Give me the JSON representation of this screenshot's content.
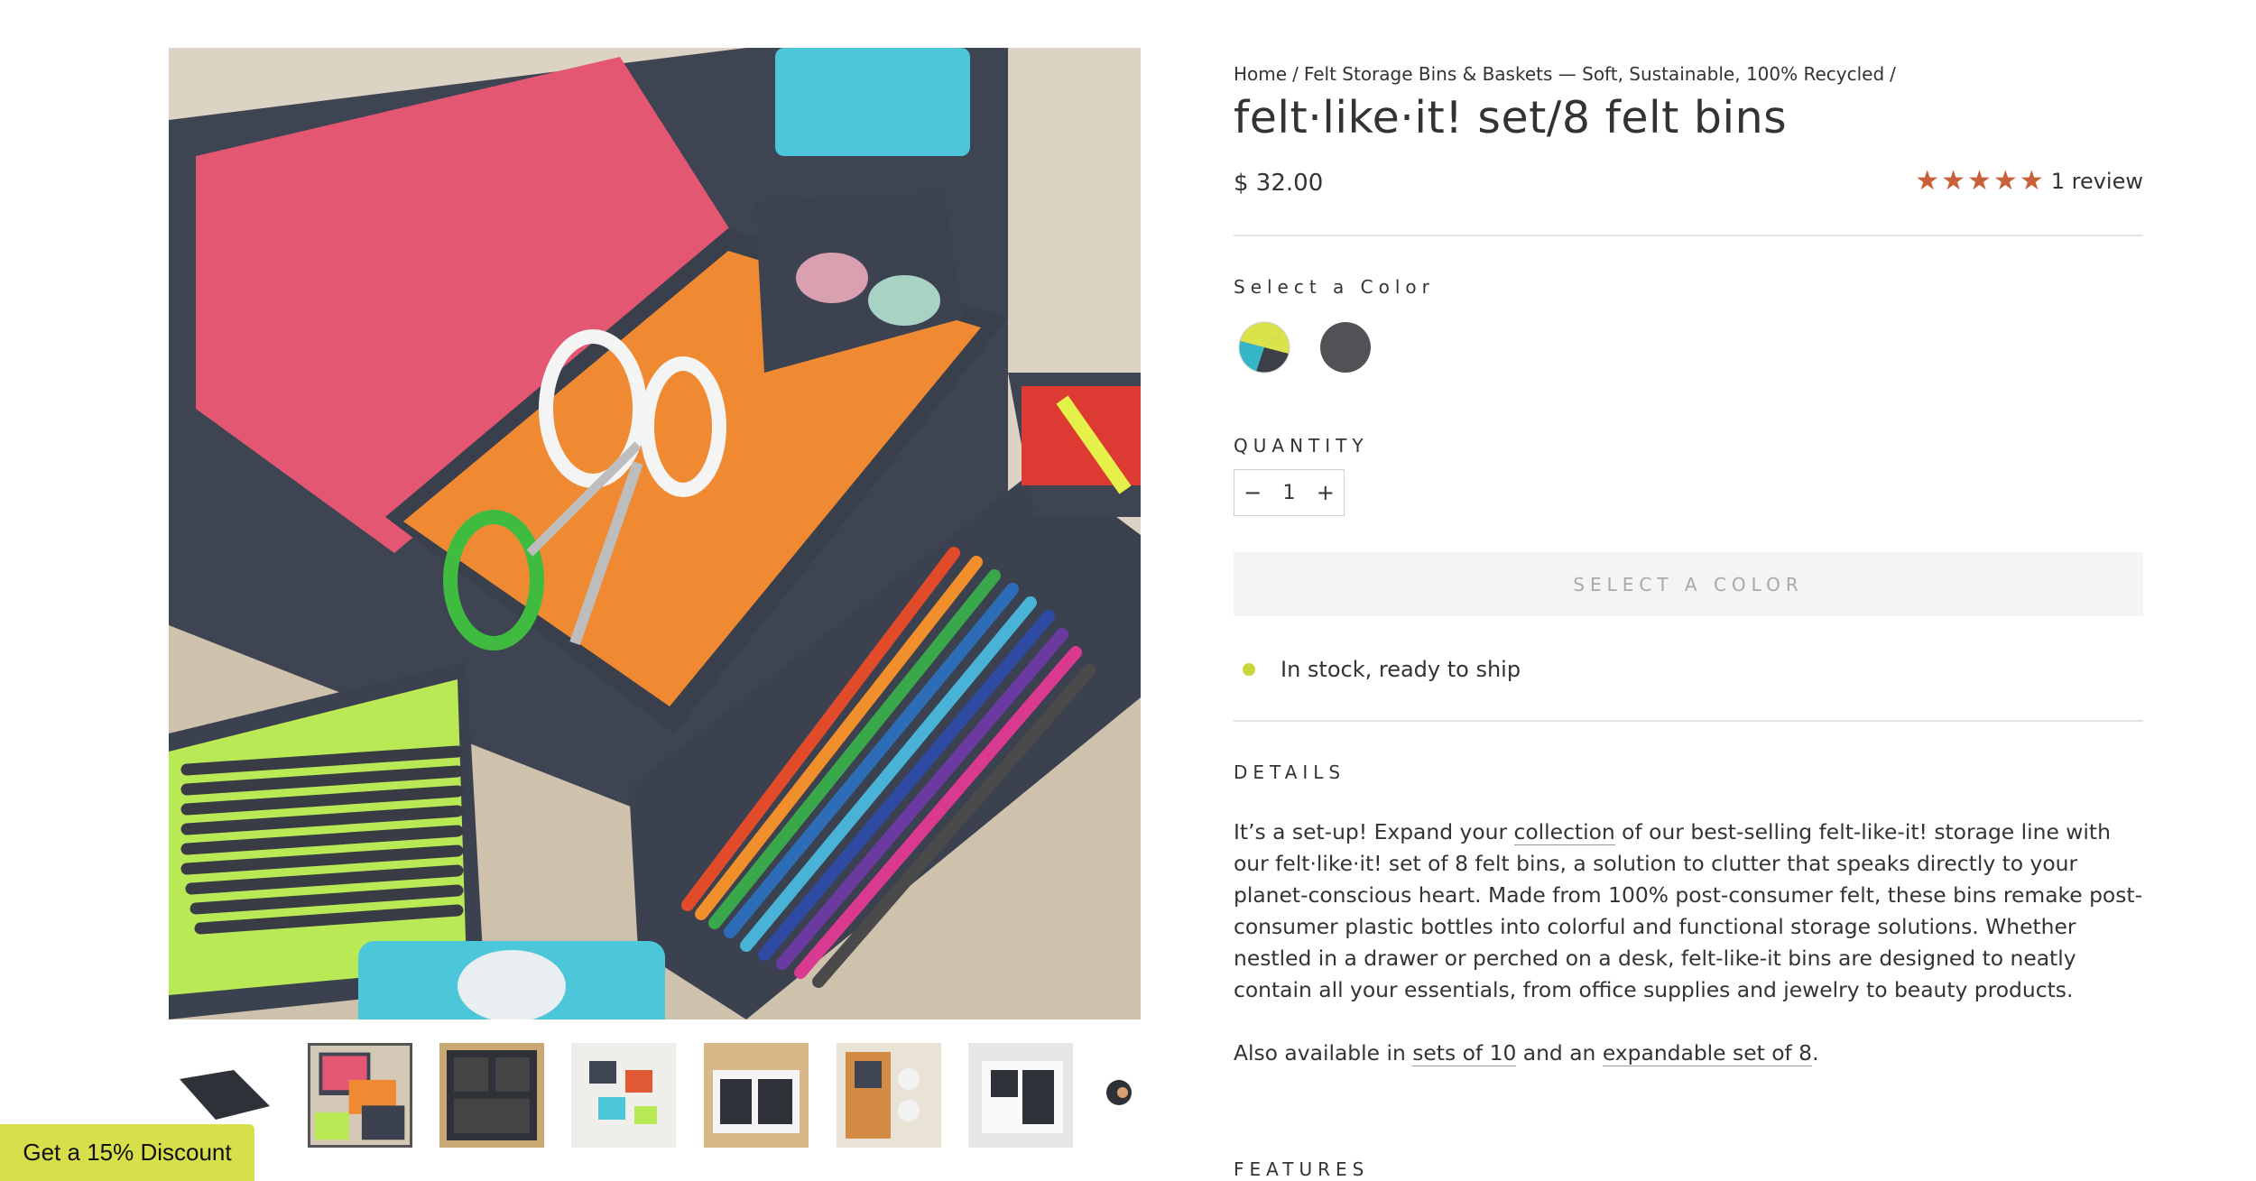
{
  "breadcrumb": {
    "home": "Home",
    "sep": "/",
    "category": "Felt Storage Bins & Baskets — Soft, Sustainable, 100% Recycled"
  },
  "product": {
    "title": "felt·like·it! set/8 felt bins",
    "price": "$ 32.00",
    "rating": {
      "stars": 5,
      "max": 5,
      "review_text": "1 review"
    }
  },
  "colors": {
    "label": "Select a Color",
    "swatches": [
      {
        "name": "multicolor",
        "colors": [
          "#dbe34c",
          "#34b6c8",
          "#3d3f48"
        ]
      },
      {
        "name": "charcoal",
        "colors": [
          "#515255"
        ]
      }
    ]
  },
  "quantity": {
    "label": "QUANTITY",
    "minus": "−",
    "value": "1",
    "plus": "+"
  },
  "cta": {
    "label": "SELECT A COLOR"
  },
  "stock": {
    "text": "In stock, ready to ship",
    "dot_color": "#c9d63a"
  },
  "details": {
    "heading": "DETAILS",
    "p1_a": "It’s a set-up! Expand your ",
    "p1_link": "collection",
    "p1_b": " of our best-selling felt-like-it! storage line with our felt·like·it! set of 8 felt bins, a solution to clutter that speaks directly to your planet-conscious heart. Made from 100% post-consumer felt, these bins remake post-consumer plastic bottles into colorful and functional storage solutions. Whether nestled in a drawer or perched on a desk, felt-like-it bins are designed to neatly contain all your essentials, from office supplies and jewelry to beauty products.",
    "also_a": "Also available in ",
    "also_link1": "sets of 10",
    "also_b": " and an ",
    "also_link2": "expandable set of 8",
    "also_c": "."
  },
  "features": {
    "heading": "FEATURES"
  },
  "discount": {
    "label": "Get a 15% Discount"
  },
  "gallery": {
    "thumbnails": [
      {
        "name": "thumb-1",
        "active": false
      },
      {
        "name": "thumb-2",
        "active": true
      },
      {
        "name": "thumb-3",
        "active": false
      },
      {
        "name": "thumb-4",
        "active": false
      },
      {
        "name": "thumb-5",
        "active": false
      },
      {
        "name": "thumb-6",
        "active": false
      },
      {
        "name": "thumb-7",
        "active": false
      },
      {
        "name": "thumb-8",
        "active": false
      }
    ]
  },
  "theme": {
    "star_color": "#c8603a",
    "accent": "#d7e04a"
  }
}
